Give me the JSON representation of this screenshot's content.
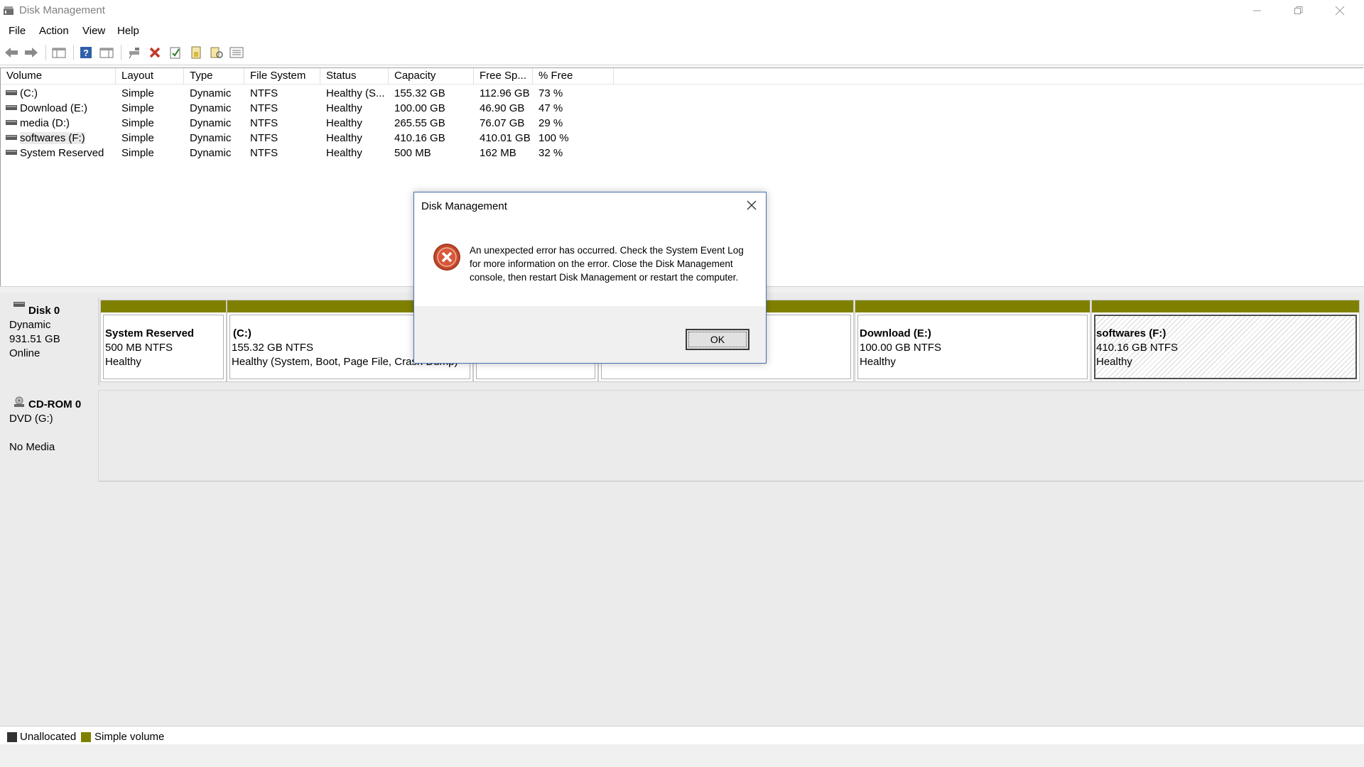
{
  "window": {
    "title": "Disk Management"
  },
  "menu": [
    "File",
    "Action",
    "View",
    "Help"
  ],
  "volumes": {
    "columns": [
      "Volume",
      "Layout",
      "Type",
      "File System",
      "Status",
      "Capacity",
      "Free Sp...",
      "% Free"
    ],
    "rows": [
      [
        "(C:)",
        "Simple",
        "Dynamic",
        "NTFS",
        "Healthy (S...",
        "155.32 GB",
        "112.96 GB",
        "73 %"
      ],
      [
        "Download (E:)",
        "Simple",
        "Dynamic",
        "NTFS",
        "Healthy",
        "100.00 GB",
        "46.90 GB",
        "47 %"
      ],
      [
        "media (D:)",
        "Simple",
        "Dynamic",
        "NTFS",
        "Healthy",
        "265.55 GB",
        "76.07 GB",
        "29 %"
      ],
      [
        "softwares (F:)",
        "Simple",
        "Dynamic",
        "NTFS",
        "Healthy",
        "410.16 GB",
        "410.01 GB",
        "100 %"
      ],
      [
        "System Reserved",
        "Simple",
        "Dynamic",
        "NTFS",
        "Healthy",
        "500 MB",
        "162 MB",
        "32 %"
      ]
    ]
  },
  "disk0": {
    "name": "Disk 0",
    "type": "Dynamic",
    "size": "931.51 GB",
    "status": "Online",
    "partitions": [
      {
        "name": "System Reserved",
        "size": "500 MB NTFS",
        "status": "Healthy"
      },
      {
        "name": "(C:)",
        "size": "155.32 GB NTFS",
        "status": "Healthy (System, Boot, Page File, Crash Dump)"
      },
      {
        "name": "",
        "size": "",
        "status": ""
      },
      {
        "name": "",
        "size": "",
        "status": ""
      },
      {
        "name": "Download  (E:)",
        "size": "100.00 GB NTFS",
        "status": "Healthy"
      },
      {
        "name": "softwares  (F:)",
        "size": "410.16 GB NTFS",
        "status": "Healthy"
      }
    ]
  },
  "cdrom0": {
    "name": "CD-ROM 0",
    "drive": "DVD (G:)",
    "media": "No Media"
  },
  "legend": {
    "unallocated": "Unallocated",
    "simple": "Simple volume"
  },
  "colors": {
    "simple_volume": "#808000",
    "unallocated": "#333333",
    "dialog_border": "#4a6fb0"
  },
  "dialog": {
    "title": "Disk Management",
    "message_lines": [
      "An unexpected error has occurred. Check the System Event Log",
      "for more information on the error. Close the Disk Management",
      "console, then restart Disk Management or restart the computer."
    ],
    "ok_label": "OK",
    "icon": "error-icon"
  }
}
